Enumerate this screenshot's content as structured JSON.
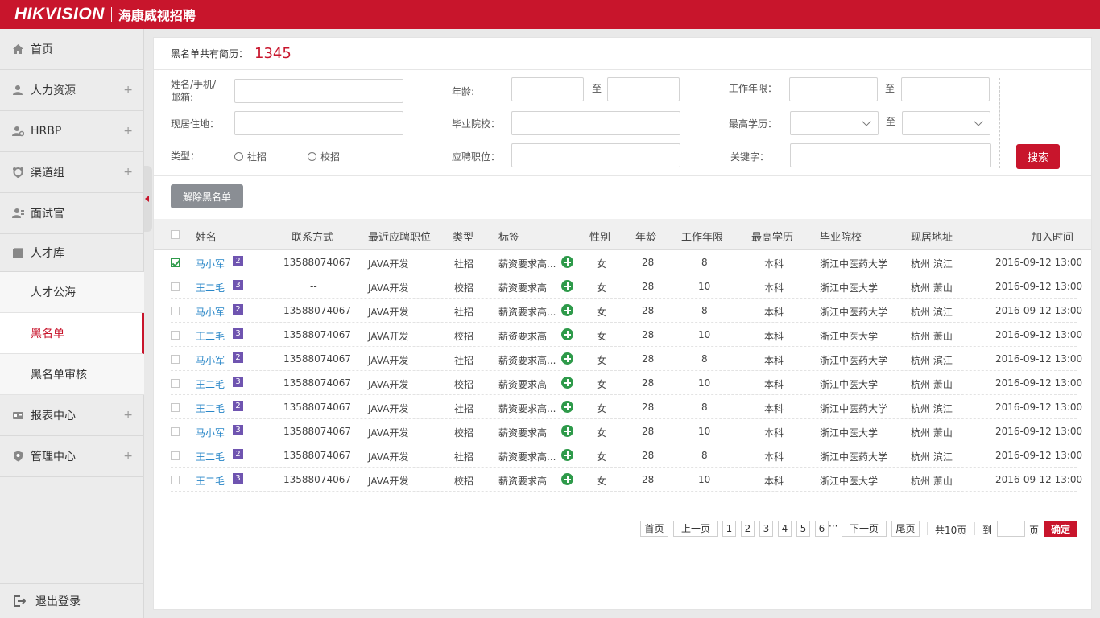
{
  "header": {
    "logo": "HIKVISION",
    "subtitle": "海康威视招聘"
  },
  "sidebar": {
    "items": [
      {
        "label": "首页",
        "icon": "home-icon",
        "expandable": false
      },
      {
        "label": "人力资源",
        "icon": "user-icon",
        "expandable": true,
        "plus": "+"
      },
      {
        "label": "HRBP",
        "icon": "user-gear-icon",
        "expandable": true,
        "plus": "+"
      },
      {
        "label": "渠道组",
        "icon": "channel-icon",
        "expandable": true,
        "plus": "+"
      },
      {
        "label": "面试官",
        "icon": "interviewer-icon",
        "expandable": false
      },
      {
        "label": "人才库",
        "icon": "book-icon",
        "expandable": false
      }
    ],
    "sub_items": [
      {
        "label": "人才公海",
        "active": false
      },
      {
        "label": "黑名单",
        "active": true
      },
      {
        "label": "黑名单审核",
        "active": false
      }
    ],
    "bottom_items": [
      {
        "label": "报表中心",
        "icon": "report-icon",
        "plus": "+"
      },
      {
        "label": "管理中心",
        "icon": "shield-icon",
        "plus": "+"
      }
    ],
    "logout": "退出登录"
  },
  "summary": {
    "label": "黑名单共有简历：",
    "count": "1345"
  },
  "filters": {
    "name_label_1": "姓名/手机/",
    "name_label_2": "邮箱:",
    "age_label": "年龄:",
    "work_years_label": "工作年限：",
    "to": "至",
    "residence_label": "现居住地：",
    "school_label": "毕业院校：",
    "education_label": "最高学历：",
    "type_label": "类型：",
    "type_options": [
      "社招",
      "校招"
    ],
    "position_label": "应聘职位：",
    "keyword_label": "关键字：",
    "search_button": "搜索"
  },
  "actions": {
    "remove_blacklist": "解除黑名单"
  },
  "table": {
    "headers": [
      "姓名",
      "联系方式",
      "最近应聘职位",
      "类型",
      "标签",
      "性别",
      "年龄",
      "工作年限",
      "最高学历",
      "毕业院校",
      "现居地址",
      "加入时间"
    ],
    "rows": [
      {
        "checked": true,
        "name": "马小军",
        "badge": "2",
        "contact": "13588074067",
        "position": "JAVA开发",
        "type": "社招",
        "tag": "薪资要求高...",
        "gender": "女",
        "age": "28",
        "years": "8",
        "education": "本科",
        "school": "浙江中医药大学",
        "address": "杭州 滨江",
        "time": "2016-09-12 13:00"
      },
      {
        "checked": false,
        "name": "王二毛",
        "badge": "3",
        "contact": "--",
        "position": "JAVA开发",
        "type": "校招",
        "tag": "薪资要求高",
        "gender": "女",
        "age": "28",
        "years": "10",
        "education": "本科",
        "school": "浙江中医大学",
        "address": "杭州 萧山",
        "time": "2016-09-12 13:00"
      },
      {
        "checked": false,
        "name": "马小军",
        "badge": "2",
        "contact": "13588074067",
        "position": "JAVA开发",
        "type": "社招",
        "tag": "薪资要求高...",
        "gender": "女",
        "age": "28",
        "years": "8",
        "education": "本科",
        "school": "浙江中医药大学",
        "address": "杭州 滨江",
        "time": "2016-09-12 13:00"
      },
      {
        "checked": false,
        "name": "王二毛",
        "badge": "3",
        "contact": "13588074067",
        "position": "JAVA开发",
        "type": "校招",
        "tag": "薪资要求高",
        "gender": "女",
        "age": "28",
        "years": "10",
        "education": "本科",
        "school": "浙江中医大学",
        "address": "杭州 萧山",
        "time": "2016-09-12 13:00"
      },
      {
        "checked": false,
        "name": "马小军",
        "badge": "2",
        "contact": "13588074067",
        "position": "JAVA开发",
        "type": "社招",
        "tag": "薪资要求高...",
        "gender": "女",
        "age": "28",
        "years": "8",
        "education": "本科",
        "school": "浙江中医药大学",
        "address": "杭州 滨江",
        "time": "2016-09-12 13:00"
      },
      {
        "checked": false,
        "name": "王二毛",
        "badge": "3",
        "contact": "13588074067",
        "position": "JAVA开发",
        "type": "校招",
        "tag": "薪资要求高",
        "gender": "女",
        "age": "28",
        "years": "10",
        "education": "本科",
        "school": "浙江中医大学",
        "address": "杭州 萧山",
        "time": "2016-09-12 13:00"
      },
      {
        "checked": false,
        "name": "王二毛",
        "badge": "2",
        "contact": "13588074067",
        "position": "JAVA开发",
        "type": "社招",
        "tag": "薪资要求高...",
        "gender": "女",
        "age": "28",
        "years": "8",
        "education": "本科",
        "school": "浙江中医药大学",
        "address": "杭州 滨江",
        "time": "2016-09-12 13:00"
      },
      {
        "checked": false,
        "name": "马小军",
        "badge": "3",
        "contact": "13588074067",
        "position": "JAVA开发",
        "type": "校招",
        "tag": "薪资要求高",
        "gender": "女",
        "age": "28",
        "years": "10",
        "education": "本科",
        "school": "浙江中医大学",
        "address": "杭州 萧山",
        "time": "2016-09-12 13:00"
      },
      {
        "checked": false,
        "name": "王二毛",
        "badge": "2",
        "contact": "13588074067",
        "position": "JAVA开发",
        "type": "社招",
        "tag": "薪资要求高...",
        "gender": "女",
        "age": "28",
        "years": "8",
        "education": "本科",
        "school": "浙江中医药大学",
        "address": "杭州 滨江",
        "time": "2016-09-12 13:00"
      },
      {
        "checked": false,
        "name": "王二毛",
        "badge": "3",
        "contact": "13588074067",
        "position": "JAVA开发",
        "type": "校招",
        "tag": "薪资要求高",
        "gender": "女",
        "age": "28",
        "years": "10",
        "education": "本科",
        "school": "浙江中医大学",
        "address": "杭州 萧山",
        "time": "2016-09-12 13:00"
      }
    ]
  },
  "pagination": {
    "first": "首页",
    "prev": "上一页",
    "pages": [
      "1",
      "2",
      "3",
      "4",
      "5",
      "6"
    ],
    "ellipsis": "···",
    "next": "下一页",
    "last": "尾页",
    "total": "共10页",
    "goto": "到",
    "page_unit": "页",
    "confirm": "确定"
  },
  "colors": {
    "brand": "#c8152c",
    "link": "#2a87c8",
    "badge": "#6f54b0",
    "plus": "#2e9a4a"
  }
}
